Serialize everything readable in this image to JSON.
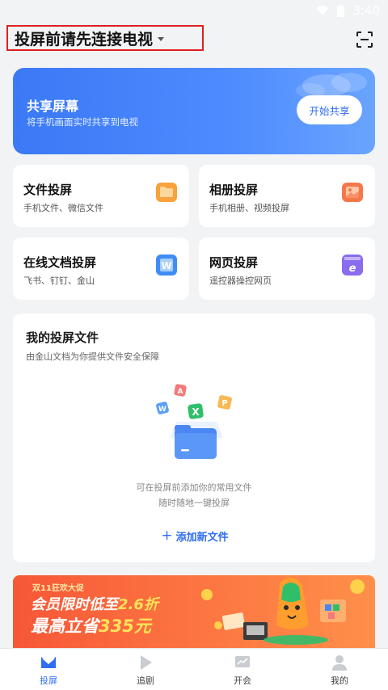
{
  "status_bar": {
    "time": "3:40"
  },
  "header": {
    "title": "投屏前请先连接电视"
  },
  "share_banner": {
    "title": "共享屏幕",
    "subtitle": "将手机画面实时共享到电视",
    "button": "开始共享"
  },
  "features": [
    {
      "title": "文件投屏",
      "subtitle": "手机文件、微信文件",
      "icon": "folder-icon",
      "color": "#f7a23b"
    },
    {
      "title": "相册投屏",
      "subtitle": "手机相册、视频投屏",
      "icon": "photo-icon",
      "color": "#f5784a"
    },
    {
      "title": "在线文档投屏",
      "subtitle": "飞书、钉钉、金山",
      "icon": "document-w-icon",
      "color": "#3f8cf5"
    },
    {
      "title": "网页投屏",
      "subtitle": "遥控器操控网页",
      "icon": "browser-e-icon",
      "color": "#8a6cf0"
    }
  ],
  "files": {
    "title": "我的投屏文件",
    "subtitle": "由金山文档为你提供文件安全保障",
    "empty_line1": "可在投屏前添加你的常用文件",
    "empty_line2": "随时随地一键投屏",
    "add_label": "添加新文件",
    "add_icon": "+"
  },
  "promo": {
    "tag": "双11狂欢大促",
    "line1_prefix": "会员限时低至",
    "line1_highlight": "2.6折",
    "line2_prefix": "最高立省",
    "line2_highlight": "335元"
  },
  "tabs": [
    {
      "label": "投屏",
      "icon": "cast-icon",
      "active": true
    },
    {
      "label": "追剧",
      "icon": "play-icon",
      "active": false
    },
    {
      "label": "开会",
      "icon": "chart-icon",
      "active": false
    },
    {
      "label": "我的",
      "icon": "user-icon",
      "active": false
    }
  ],
  "colors": {
    "accent": "#2f6df2",
    "highlight_border": "#e02020"
  }
}
